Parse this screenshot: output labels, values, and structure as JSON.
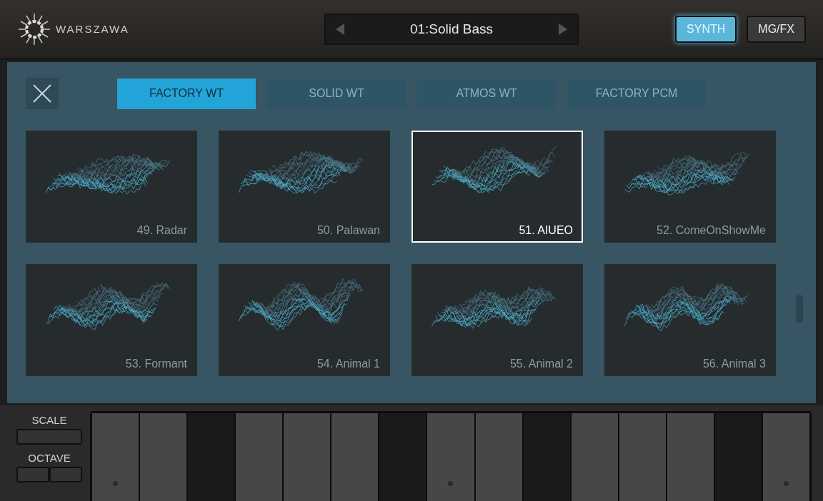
{
  "header": {
    "logo": "WARSZAWA",
    "preset": {
      "name": "01:Solid Bass"
    },
    "modes": [
      {
        "label": "SYNTH",
        "selected": true
      },
      {
        "label": "MG/FX",
        "selected": false
      }
    ]
  },
  "tabs": [
    {
      "label": "FACTORY WT",
      "selected": true
    },
    {
      "label": "SOLID WT",
      "selected": false
    },
    {
      "label": "ATMOS WT",
      "selected": false
    },
    {
      "label": "FACTORY PCM",
      "selected": false
    }
  ],
  "wavetables": [
    {
      "label": "49. Radar",
      "selected": false
    },
    {
      "label": "50. Palawan",
      "selected": false
    },
    {
      "label": "51. AIUEO",
      "selected": true
    },
    {
      "label": "52. ComeOnShowMe",
      "selected": false
    },
    {
      "label": "53. Formant",
      "selected": false
    },
    {
      "label": "54. Animal 1",
      "selected": false
    },
    {
      "label": "55. Animal 2",
      "selected": false
    },
    {
      "label": "56. Animal 3",
      "selected": false
    }
  ],
  "keyboard": {
    "scale_label": "SCALE",
    "octave_label": "OCTAVE",
    "keys": [
      {
        "kind": "white",
        "dot": true
      },
      {
        "kind": "white",
        "dot": false
      },
      {
        "kind": "black",
        "dot": false
      },
      {
        "kind": "white",
        "dot": false
      },
      {
        "kind": "white",
        "dot": false
      },
      {
        "kind": "white",
        "dot": false
      },
      {
        "kind": "black",
        "dot": false
      },
      {
        "kind": "white",
        "dot": true
      },
      {
        "kind": "white",
        "dot": false
      },
      {
        "kind": "black",
        "dot": false
      },
      {
        "kind": "white",
        "dot": false
      },
      {
        "kind": "white",
        "dot": false
      },
      {
        "kind": "white",
        "dot": false
      },
      {
        "kind": "black",
        "dot": false
      },
      {
        "kind": "white",
        "dot": true
      }
    ]
  }
}
